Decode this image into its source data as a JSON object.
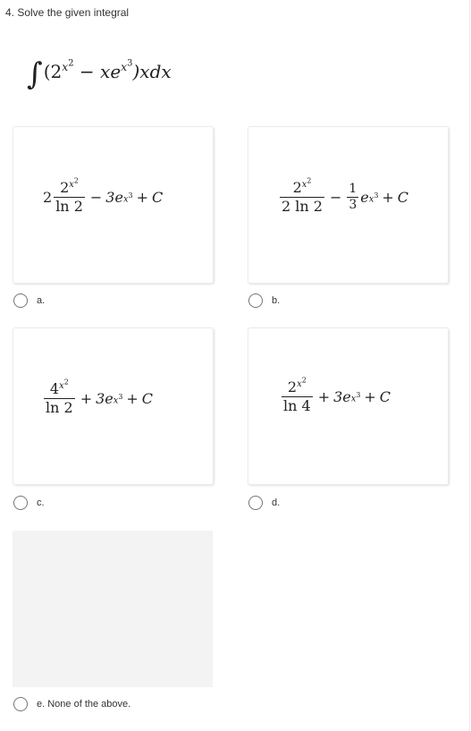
{
  "question": {
    "title": "4. Solve the given integral",
    "integral": {
      "sign": "∫",
      "open": "(2",
      "exp1_base": "x",
      "exp1_pow": "2",
      "minus": " − ",
      "xe": "xe",
      "exp2_base": "x",
      "exp2_pow": "3",
      "close": ")xdx"
    }
  },
  "options": [
    {
      "id": "a",
      "label": "a.",
      "expression": {
        "coef": "2",
        "num_base": "2",
        "num_exp_base": "x",
        "num_exp_pow": "2",
        "den": "ln 2",
        "op1": "−",
        "term2": "3e",
        "term2_exp_base": "x",
        "term2_exp_pow": "3",
        "op2": "+",
        "const": "C"
      }
    },
    {
      "id": "b",
      "label": "b.",
      "expression": {
        "num_base": "2",
        "num_exp_base": "x",
        "num_exp_pow": "2",
        "den": "2 ln 2",
        "op1": "−",
        "frac2_num": "1",
        "frac2_den": "3",
        "term2": "e",
        "term2_exp_base": "x",
        "term2_exp_pow": "3",
        "op2": "+",
        "const": "C"
      }
    },
    {
      "id": "c",
      "label": "c.",
      "expression": {
        "num_base": "4",
        "num_exp_base": "x",
        "num_exp_pow": "2",
        "den": "ln 2",
        "op1": "+",
        "term2": "3e",
        "term2_exp_base": "x",
        "term2_exp_pow": "3",
        "op2": "+",
        "const": "C"
      }
    },
    {
      "id": "d",
      "label": "d.",
      "expression": {
        "num_base": "2",
        "num_exp_base": "x",
        "num_exp_pow": "2",
        "den": "ln 4",
        "op1": "+",
        "term2": "3e",
        "term2_exp_base": "x",
        "term2_exp_pow": "3",
        "op2": "+",
        "const": "C"
      }
    },
    {
      "id": "e",
      "label": "e. None of the above."
    }
  ]
}
